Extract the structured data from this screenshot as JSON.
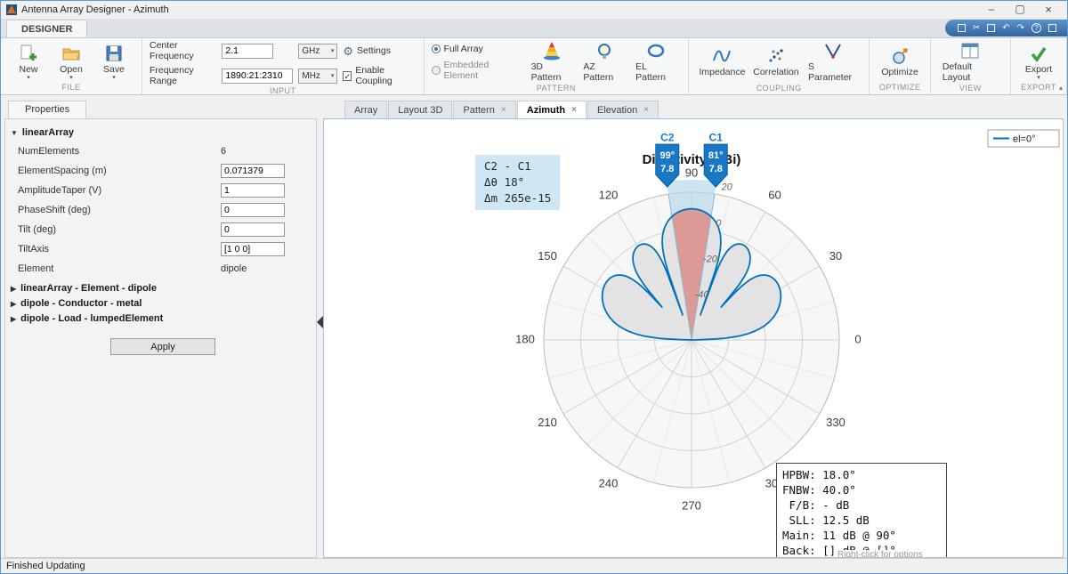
{
  "window": {
    "title": "Antenna Array Designer - Azimuth"
  },
  "ribbon": {
    "tab_label": "DESIGNER",
    "file": {
      "label": "FILE",
      "new_label": "New",
      "open_label": "Open",
      "save_label": "Save"
    },
    "input": {
      "label": "INPUT",
      "center_frequency_label": "Center Frequency",
      "center_frequency_value": "2.1",
      "center_frequency_unit": "GHz",
      "settings_label": "Settings",
      "frequency_range_label": "Frequency Range",
      "frequency_range_value": "1890:21:2310",
      "frequency_range_unit": "MHz",
      "enable_coupling_label": "Enable Coupling"
    },
    "pattern": {
      "label": "PATTERN",
      "full_array_label": "Full Array",
      "embedded_element_label": "Embedded Element",
      "buttons": [
        "3D Pattern",
        "AZ Pattern",
        "EL Pattern"
      ]
    },
    "coupling": {
      "label": "COUPLING",
      "buttons": [
        "Impedance",
        "Correlation",
        "S Parameter"
      ]
    },
    "optimize": {
      "label": "OPTIMIZE",
      "button": "Optimize"
    },
    "view": {
      "label": "VIEW",
      "button": "Default Layout"
    },
    "export": {
      "label": "EXPORT",
      "button": "Export"
    }
  },
  "properties": {
    "tab": "Properties",
    "section": "linearArray",
    "rows": [
      {
        "label": "NumElements",
        "value": "6",
        "type": "text"
      },
      {
        "label": "ElementSpacing (m)",
        "value": "0.071379",
        "type": "input"
      },
      {
        "label": "AmplitudeTaper (V)",
        "value": "1",
        "type": "input"
      },
      {
        "label": "PhaseShift (deg)",
        "value": "0",
        "type": "input"
      },
      {
        "label": "Tilt (deg)",
        "value": "0",
        "type": "input"
      },
      {
        "label": "TiltAxis",
        "value": "[1 0 0]",
        "type": "input"
      },
      {
        "label": "Element",
        "value": "dipole",
        "type": "text"
      }
    ],
    "collapsed_sections": [
      "linearArray - Element - dipole",
      "dipole - Conductor - metal",
      "dipole - Load - lumpedElement"
    ],
    "apply_label": "Apply"
  },
  "doc_tabs": [
    {
      "label": "Array",
      "closable": false,
      "active": false
    },
    {
      "label": "Layout 3D",
      "closable": false,
      "active": false
    },
    {
      "label": "Pattern",
      "closable": true,
      "active": false
    },
    {
      "label": "Azimuth",
      "closable": true,
      "active": true
    },
    {
      "label": "Elevation",
      "closable": true,
      "active": false
    }
  ],
  "status_bar": "Finished Updating",
  "chart_data": {
    "type": "polar",
    "title": "Directivity (dBi)",
    "legend": [
      "el=0°"
    ],
    "line_color": "#0072BD",
    "angle_ticks": [
      0,
      30,
      60,
      90,
      120,
      150,
      180,
      210,
      240,
      270,
      300,
      330
    ],
    "r_ticks": [
      20,
      0,
      -20,
      -40
    ],
    "r_range": [
      -60,
      20
    ],
    "pattern": {
      "num_elements": 6,
      "spacing_wavelengths": 0.5,
      "peak_dbi": 11,
      "main_angle": 90
    },
    "cursors": [
      {
        "id": "C1",
        "angle": 81,
        "value": "7.8"
      },
      {
        "id": "C2",
        "angle": 99,
        "value": "7.8"
      }
    ],
    "cursor_info": [
      "C2 - C1",
      "Δθ 18°",
      "Δm 265e-15"
    ],
    "stats": [
      "HPBW: 18.0°",
      "FNBW: 40.0°",
      " F/B: - dB",
      " SLL: 12.5 dB",
      "Main: 11 dB @ 90°",
      "Back: [] dB @ []°"
    ],
    "hint": "Right-click for options"
  }
}
